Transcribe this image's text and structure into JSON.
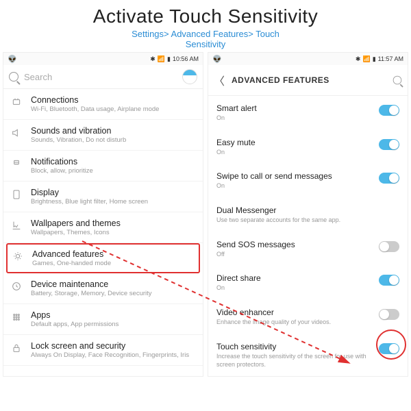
{
  "header": {
    "title": "Activate Touch Sensitivity",
    "path_line1": "Settings> Advanced Features> Touch",
    "path_line2": "Sensitivity"
  },
  "left": {
    "status_time": "10:56 AM",
    "search_placeholder": "Search",
    "items": [
      {
        "icon": "connections",
        "title": "Connections",
        "sub": "Wi-Fi, Bluetooth, Data usage, Airplane mode"
      },
      {
        "icon": "sound",
        "title": "Sounds and vibration",
        "sub": "Sounds, Vibration, Do not disturb"
      },
      {
        "icon": "notifications",
        "title": "Notifications",
        "sub": "Block, allow, prioritize"
      },
      {
        "icon": "display",
        "title": "Display",
        "sub": "Brightness, Blue light filter, Home screen"
      },
      {
        "icon": "wallpaper",
        "title": "Wallpapers and themes",
        "sub": "Wallpapers, Themes, Icons"
      },
      {
        "icon": "advanced",
        "title": "Advanced features",
        "sub": "Games, One-handed mode"
      },
      {
        "icon": "maintenance",
        "title": "Device maintenance",
        "sub": "Battery, Storage, Memory, Device security"
      },
      {
        "icon": "apps",
        "title": "Apps",
        "sub": "Default apps, App permissions"
      },
      {
        "icon": "lock",
        "title": "Lock screen and security",
        "sub": "Always On Display, Face Recognition, Fingerprints, Iris"
      }
    ]
  },
  "right": {
    "status_time": "11:57 AM",
    "title": "ADVANCED FEATURES",
    "items": [
      {
        "title": "Smart alert",
        "sub": "On",
        "toggle": "on"
      },
      {
        "title": "Easy mute",
        "sub": "On",
        "toggle": "on"
      },
      {
        "title": "Swipe to call or send messages",
        "sub": "On",
        "toggle": "on"
      },
      {
        "title": "Dual Messenger",
        "sub": "Use two separate accounts for the same app.",
        "toggle": null
      },
      {
        "title": "Send SOS messages",
        "sub": "Off",
        "toggle": "off"
      },
      {
        "title": "Direct share",
        "sub": "On",
        "toggle": "on"
      },
      {
        "title": "Video enhancer",
        "sub": "Enhance the image quality of your videos.",
        "toggle": "off"
      },
      {
        "title": "Touch sensitivity",
        "sub": "Increase the touch sensitivity of the screen for use with screen protectors.",
        "toggle": "on"
      }
    ]
  }
}
